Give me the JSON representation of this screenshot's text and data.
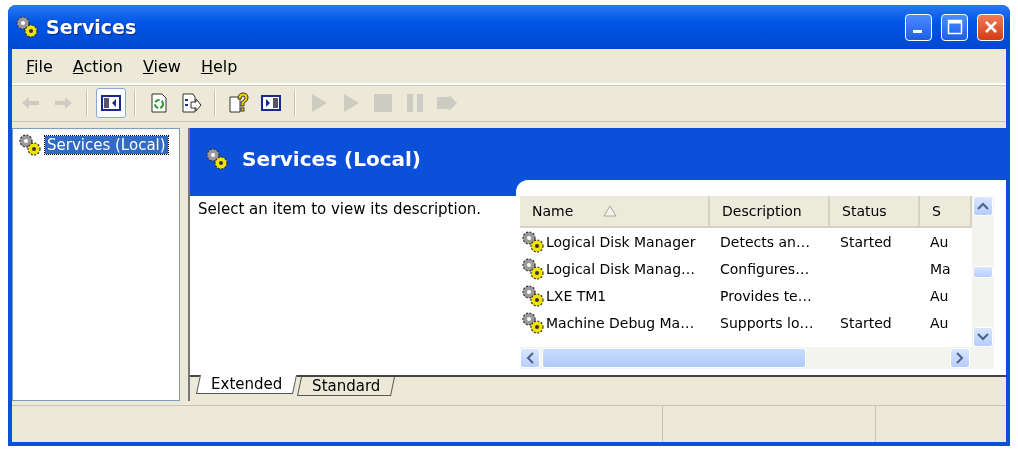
{
  "window": {
    "title": "Services"
  },
  "menu": [
    {
      "label": "File",
      "underlined": true
    },
    {
      "label": "Action",
      "underlined": true
    },
    {
      "label": "View",
      "underlined": true
    },
    {
      "label": "Help",
      "underlined": true
    }
  ],
  "toolbar": [
    {
      "kind": "back",
      "disabled": true,
      "pressed": false
    },
    {
      "kind": "forward",
      "disabled": true,
      "pressed": false
    },
    {
      "kind": "sep"
    },
    {
      "kind": "tree",
      "disabled": false,
      "pressed": true
    },
    {
      "kind": "sep"
    },
    {
      "kind": "refresh",
      "disabled": false,
      "pressed": false
    },
    {
      "kind": "export",
      "disabled": false,
      "pressed": false
    },
    {
      "kind": "sep"
    },
    {
      "kind": "help",
      "disabled": false,
      "pressed": false
    },
    {
      "kind": "pane",
      "disabled": false,
      "pressed": false
    },
    {
      "kind": "sep"
    },
    {
      "kind": "play",
      "disabled": true,
      "pressed": false
    },
    {
      "kind": "play",
      "disabled": true,
      "pressed": false
    },
    {
      "kind": "stop",
      "disabled": true,
      "pressed": false
    },
    {
      "kind": "pause",
      "disabled": true,
      "pressed": false
    },
    {
      "kind": "restart",
      "disabled": true,
      "pressed": false
    }
  ],
  "tree": [
    {
      "label": "Services (Local)",
      "selected": true
    }
  ],
  "panel": {
    "title": "Services (Local)",
    "description": "Select an item to view its description."
  },
  "table": {
    "columns": [
      {
        "label": "Name",
        "sorted": true
      },
      {
        "label": "Description",
        "sorted": false
      },
      {
        "label": "Status",
        "sorted": false
      },
      {
        "label": "S",
        "sorted": false
      }
    ],
    "rows": [
      [
        "Logical Disk Manager",
        "Detects an…",
        "Started",
        "Au"
      ],
      [
        "Logical Disk Manag…",
        "Configures…",
        "",
        "Ma"
      ],
      [
        "LXE TM1",
        "Provides te…",
        "",
        "Au"
      ],
      [
        "Machine Debug Ma…",
        "Supports lo…",
        "Started",
        "Au"
      ]
    ]
  },
  "tabs": [
    {
      "label": "Extended",
      "selected": true
    },
    {
      "label": "Standard",
      "selected": false
    }
  ]
}
